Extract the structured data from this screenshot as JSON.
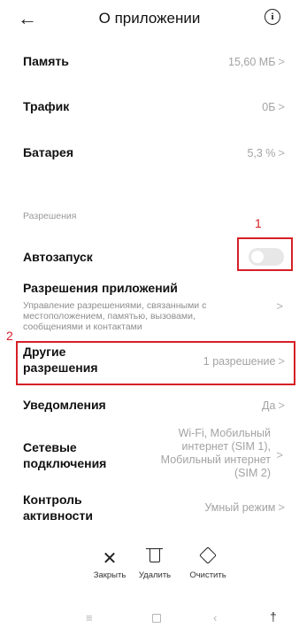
{
  "header": {
    "title": "О приложении",
    "back_icon": "arrow-left-icon",
    "info_icon": "info-icon"
  },
  "rows": {
    "memory": {
      "label": "Память",
      "value": "15,60 МБ"
    },
    "traffic": {
      "label": "Трафик",
      "value": "0Б"
    },
    "battery": {
      "label": "Батарея",
      "value": "5,3 %"
    }
  },
  "permissions_section": {
    "title": "Разрешения"
  },
  "autostart": {
    "label": "Автозапуск",
    "enabled": false
  },
  "app_permissions": {
    "label": "Разрешения приложений",
    "description": "Управление разрешениями, связанными с местоположением, памятью, вызовами, сообщениями и контактами"
  },
  "other_permissions": {
    "label_line1": "Другие",
    "label_line2": "разрешения",
    "value": "1 разрешение"
  },
  "notifications": {
    "label": "Уведомления",
    "value": "Да"
  },
  "network": {
    "label_line1": "Сетевые",
    "label_line2": "подключения",
    "value_lines": [
      "Wi-Fi, Мобильный",
      "интернет (SIM 1),",
      "Мобильный интернет",
      "(SIM 2)"
    ]
  },
  "activity": {
    "label_line1": "Контроль",
    "label_line2": "активности",
    "value": "Умный режим"
  },
  "annotations": {
    "mark1": "1",
    "mark2": "2",
    "color": "#d61f26"
  },
  "bottom_bar": {
    "close": {
      "label": "Закрыть",
      "icon": "close-icon"
    },
    "delete": {
      "label": "Удалить",
      "icon": "trash-icon"
    },
    "clear": {
      "label": "Очистить",
      "icon": "eraser-icon"
    }
  },
  "system_nav": {
    "menu_icon": "menu-icon",
    "home_icon": "home-square-icon",
    "back_icon": "back-triangle-icon",
    "accessibility_icon": "accessibility-icon"
  }
}
